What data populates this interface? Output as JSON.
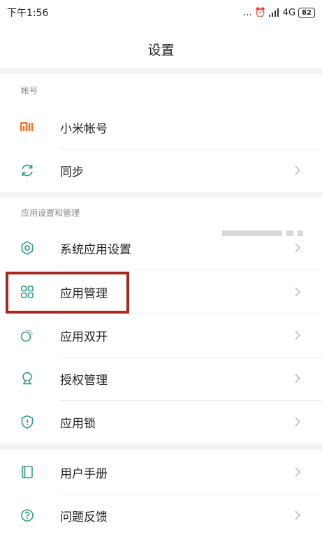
{
  "status_bar": {
    "time": "下午1:56",
    "dots": "...",
    "alarm_glyph": "⏰",
    "network": "4G",
    "battery": "82"
  },
  "header": {
    "title": "设置"
  },
  "sections": {
    "account": {
      "header": "帐号",
      "items": [
        {
          "label": "小米帐号",
          "icon": "mi-logo-icon"
        },
        {
          "label": "同步",
          "icon": "sync-icon"
        }
      ]
    },
    "apps": {
      "header": "应用设置和管理",
      "items": [
        {
          "label": "系统应用设置",
          "icon": "gear-icon"
        },
        {
          "label": "应用管理",
          "icon": "grid-icon"
        },
        {
          "label": "应用双开",
          "icon": "dual-app-icon"
        },
        {
          "label": "授权管理",
          "icon": "badge-icon"
        },
        {
          "label": "应用锁",
          "icon": "shield-icon"
        }
      ]
    },
    "help": {
      "items": [
        {
          "label": "用户手册",
          "icon": "book-icon"
        },
        {
          "label": "问题反馈",
          "icon": "question-icon"
        }
      ]
    }
  },
  "colors": {
    "mi_orange": "#f26e22",
    "icon_teal": "#2e9b8a",
    "highlight_red": "#a32a23"
  }
}
